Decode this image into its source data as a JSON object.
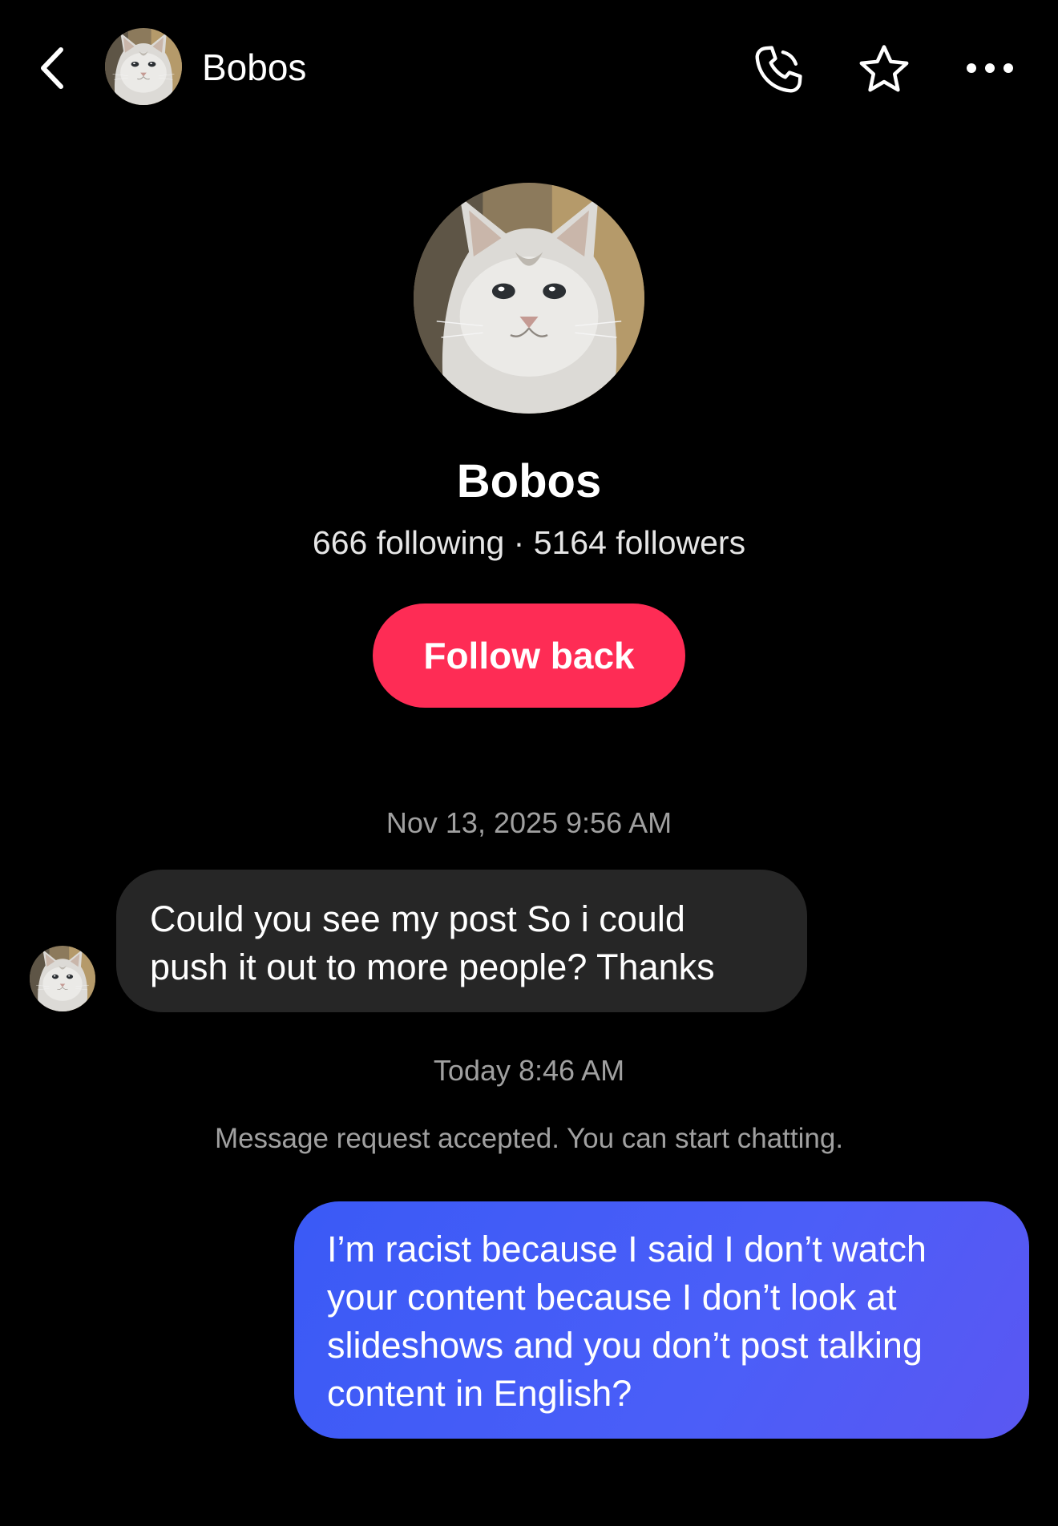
{
  "header": {
    "back_icon": "chevron-left-icon",
    "avatar": "cat-avatar",
    "name": "Bobos",
    "actions": [
      "phone-icon",
      "star-icon",
      "more-horizontal-icon"
    ]
  },
  "profile": {
    "avatar": "cat-avatar",
    "name": "Bobos",
    "stats": "666 following · 5164 followers",
    "follow_button": "Follow back"
  },
  "conversation": {
    "messages": [
      {
        "timestamp": "Nov 13, 2025 9:56 AM",
        "direction": "incoming",
        "lines": [
          "Could you see my post So i could",
          "push it out to more people? Thanks"
        ]
      },
      {
        "timestamp": "Today 8:46 AM",
        "system_note": "Message request accepted. You can start chatting.",
        "direction": "outgoing",
        "lines": [
          "I’m racist because I said I don’t watch",
          "your content because I don’t look at",
          "slideshows and you don’t post talking",
          "content in English?"
        ]
      }
    ]
  },
  "colors": {
    "background": "#000000",
    "follow_button": "#fe2c55",
    "incoming_bubble": "#262626",
    "outgoing_bubble": "#3a5af6",
    "timestamp_text": "#a0a0a0"
  }
}
